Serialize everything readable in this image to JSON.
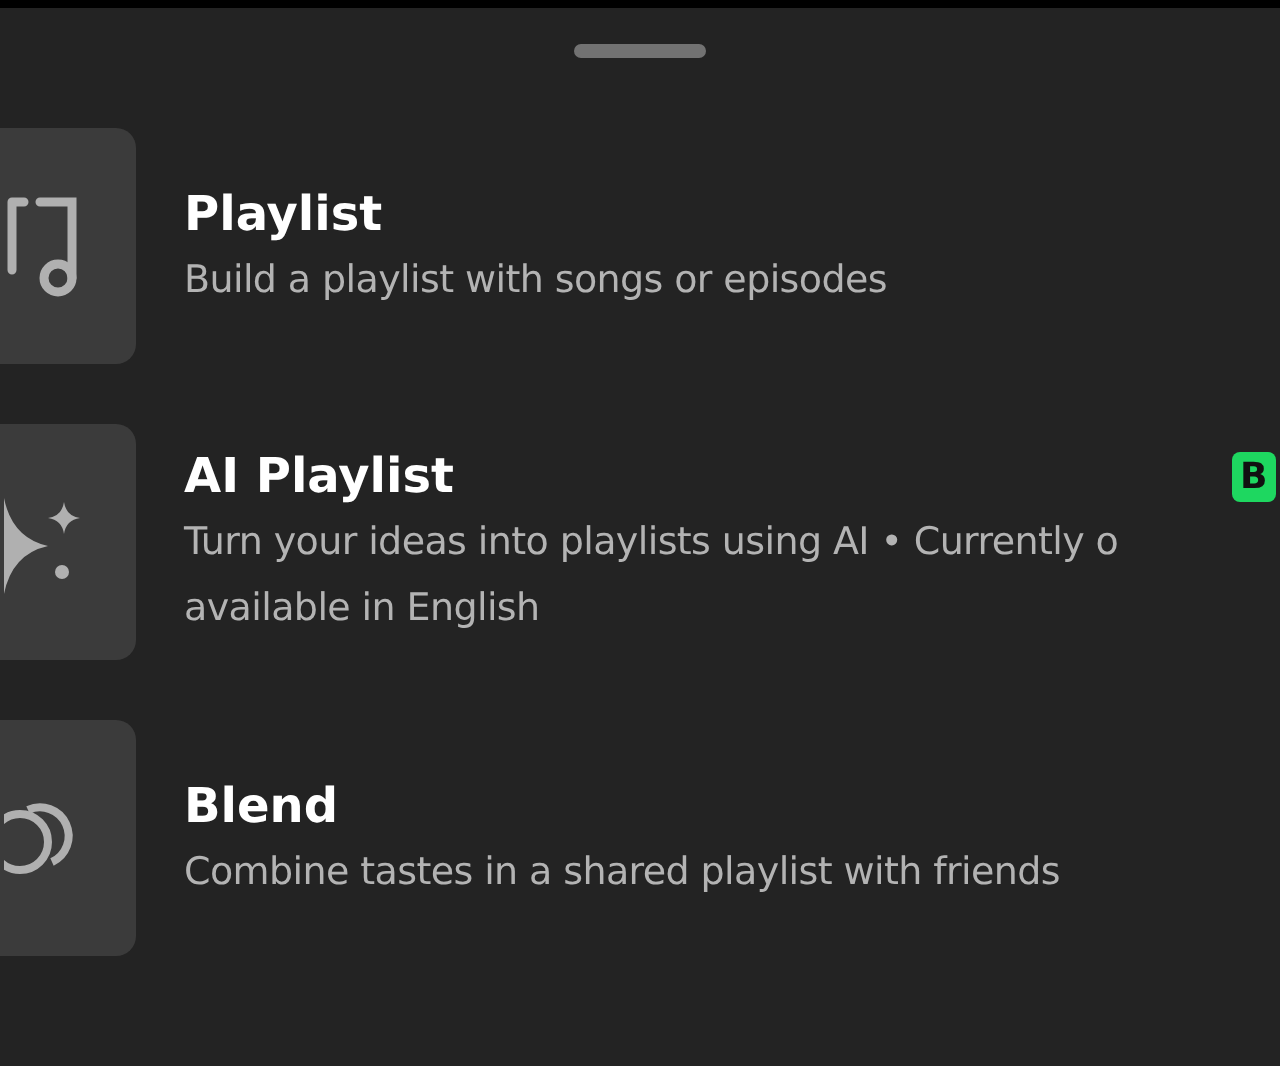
{
  "items": [
    {
      "title": "Playlist",
      "description_lines": [
        "Build a playlist with songs or episodes"
      ]
    },
    {
      "title": "AI Playlist",
      "badge": "B",
      "description_lines": [
        "Turn your ideas into playlists using AI • Currently o",
        "available in English"
      ]
    },
    {
      "title": "Blend",
      "description_lines": [
        "Combine tastes in a shared playlist with friends"
      ]
    }
  ]
}
